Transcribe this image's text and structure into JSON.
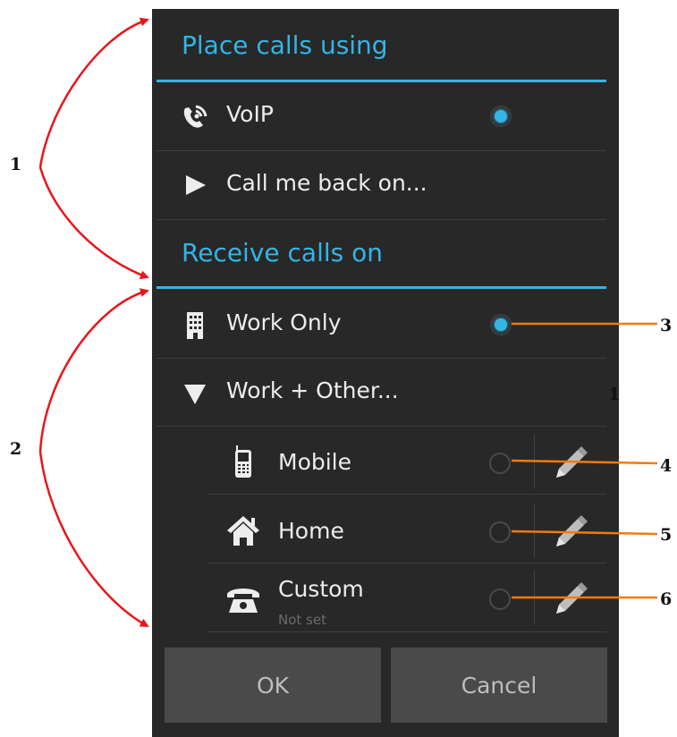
{
  "dialog": {
    "place_header": "Place calls using",
    "receive_header": "Receive calls on",
    "place_options": [
      {
        "label": "VoIP",
        "icon": "voip-phone-icon",
        "selected": true
      },
      {
        "label": "Call me back on...",
        "icon": "play-triangle-icon"
      }
    ],
    "receive_options": [
      {
        "label": "Work Only",
        "icon": "office-building-icon",
        "selected": true
      },
      {
        "label": "Work + Other...",
        "icon": "triangle-down-icon"
      }
    ],
    "other_numbers": [
      {
        "label": "Mobile",
        "icon": "mobile-phone-icon",
        "selected": false
      },
      {
        "label": "Home",
        "icon": "house-icon",
        "selected": false
      },
      {
        "label": "Custom",
        "sublabel": "Not set",
        "icon": "desk-phone-icon",
        "selected": false
      }
    ],
    "buttons": {
      "ok": "OK",
      "cancel": "Cancel"
    }
  },
  "annotations": [
    "1",
    "2",
    "3",
    "4",
    "5",
    "6",
    "1"
  ],
  "colors": {
    "accent": "#33b5e5",
    "callout_left": "#e8161a",
    "callout_right": "#f07b0e"
  }
}
